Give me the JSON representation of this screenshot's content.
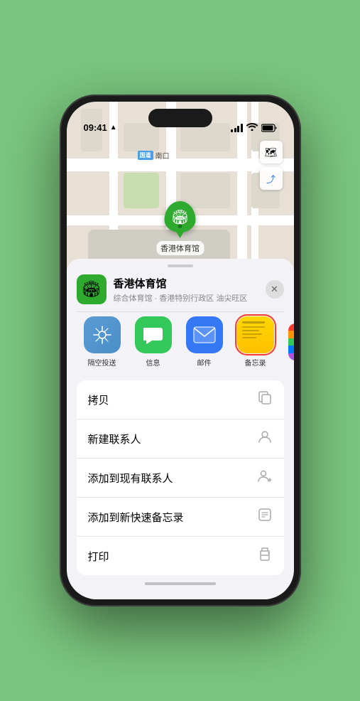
{
  "status_bar": {
    "time": "09:41",
    "location_icon": "▲"
  },
  "map": {
    "road_label_badge": "国道",
    "road_label_text": "南口"
  },
  "venue": {
    "name": "香港体育馆",
    "description": "综合体育馆 · 香港特别行政区 油尖旺区",
    "pin_emoji": "🏟️"
  },
  "share_actions": [
    {
      "id": "airdrop",
      "label": "隔空投送"
    },
    {
      "id": "message",
      "label": "信息"
    },
    {
      "id": "mail",
      "label": "邮件"
    },
    {
      "id": "notes",
      "label": "备忘录"
    }
  ],
  "menu_items": [
    {
      "label": "拷贝",
      "icon": "copy"
    },
    {
      "label": "新建联系人",
      "icon": "person"
    },
    {
      "label": "添加到现有联系人",
      "icon": "person-add"
    },
    {
      "label": "添加到新快速备忘录",
      "icon": "note"
    },
    {
      "label": "打印",
      "icon": "printer"
    }
  ],
  "controls": {
    "map_icon": "🗺",
    "location_icon": "⤴"
  }
}
